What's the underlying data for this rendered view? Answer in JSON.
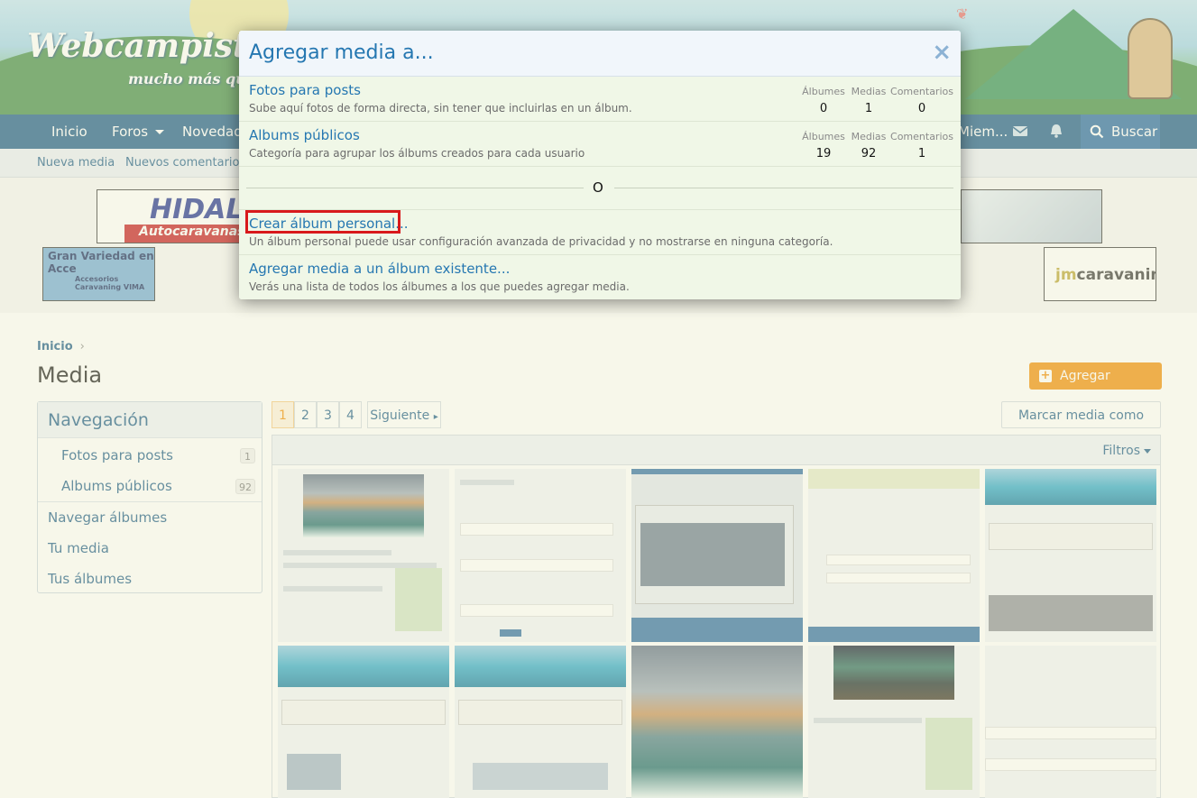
{
  "site": {
    "logo": "Webcampista.com",
    "tagline": "mucho más que una web"
  },
  "nav": {
    "items": [
      "Inicio",
      "Foros",
      "Novedades",
      "Miem..."
    ],
    "search": "Buscar"
  },
  "subnav": {
    "items": [
      "Nueva media",
      "Nuevos comentarios"
    ]
  },
  "ads": {
    "hidalgo_line1": "HIDALGO",
    "hidalgo_line2": "Autocaravanas",
    "variedad_line1": "Gran Variedad en",
    "variedad_line2": "Acce",
    "variedad_line3": "Accesorios",
    "variedad_line4": "Caravaning VIMA",
    "jm_prefix": "jm",
    "jm_text": "caravaning"
  },
  "page": {
    "breadcrumb": "Inicio",
    "title": "Media",
    "add_button": "Agregar media...",
    "mark_button": "Marcar media como vista",
    "filters": "Filtros"
  },
  "sidebar": {
    "heading": "Navegación",
    "items": [
      {
        "label": "Fotos para posts",
        "count": "1"
      },
      {
        "label": "Albums públicos",
        "count": "92"
      },
      {
        "label": "Navegar álbumes"
      },
      {
        "label": "Tu media"
      },
      {
        "label": "Tus álbumes"
      }
    ]
  },
  "pagination": {
    "pages": [
      "1",
      "2",
      "3",
      "4"
    ],
    "next": "Siguiente"
  },
  "modal": {
    "title": "Agregar media a...",
    "close": "×",
    "rows": [
      {
        "title": "Fotos para posts",
        "desc": "Sube aquí fotos de forma directa, sin tener que incluirlas en un álbum.",
        "stats": [
          {
            "label": "Álbumes",
            "value": "0"
          },
          {
            "label": "Medias",
            "value": "1"
          },
          {
            "label": "Comentarios",
            "value": "0"
          }
        ]
      },
      {
        "title": "Albums públicos",
        "desc": "Categoría para agrupar los álbums creados para cada usuario",
        "stats": [
          {
            "label": "Álbumes",
            "value": "19"
          },
          {
            "label": "Medias",
            "value": "92"
          },
          {
            "label": "Comentarios",
            "value": "1"
          }
        ]
      }
    ],
    "separator": "O",
    "create_album": {
      "title": "Crear álbum personal...",
      "desc": "Un álbum personal puede usar configuración avanzada de privacidad y no mostrarse en ninguna categoría."
    },
    "existing_album": {
      "title": "Agregar media a un álbum existente...",
      "desc": "Verás una lista de todos los álbumes a los que puedes agregar media."
    }
  },
  "colors": {
    "nav": "#185886",
    "link": "#2577b1",
    "accent": "#f08c00",
    "highlight": "#d8191b",
    "overlay": "#ebebc8"
  }
}
